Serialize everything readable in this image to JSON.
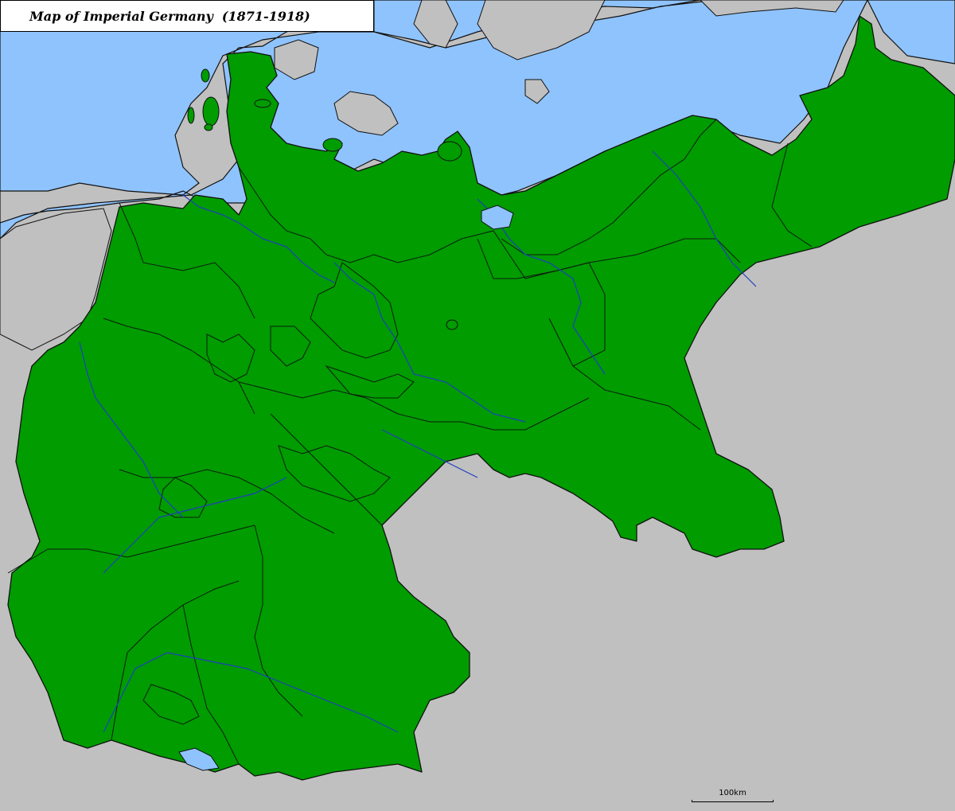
{
  "map": {
    "title": "Map of Imperial Germany  (1871-1918)",
    "scale_label": "100km"
  },
  "colors": {
    "sea": "#8fc3fd",
    "foreign_land": "#c0c0c0",
    "empire_land": "#009c00",
    "border": "#111111",
    "river": "#1f3fbf"
  },
  "layers": {
    "sea": "North Sea and Baltic Sea",
    "foreign_land": "neighbouring countries",
    "empire": "German Empire",
    "internal_borders": "state borders",
    "rivers": "rivers"
  }
}
